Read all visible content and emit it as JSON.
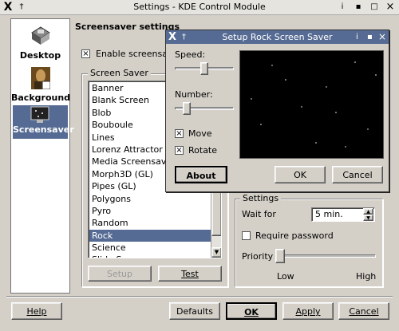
{
  "window": {
    "title": "Settings - KDE Control Module",
    "x_glyph": "X",
    "pin_glyph": "†",
    "btn_info": "i",
    "btn_min": "▪",
    "btn_max": "□",
    "btn_close": "×"
  },
  "sidebar": {
    "items": [
      {
        "label": "Desktop",
        "icon": "desktop-icon"
      },
      {
        "label": "Background",
        "icon": "background-icon"
      },
      {
        "label": "Screensaver",
        "icon": "screensaver-icon",
        "selected": true
      }
    ]
  },
  "main": {
    "heading": "Screensaver settings",
    "enable_label": "Enable screensave",
    "enable_checked": true,
    "saver_group_title": "Screen Saver",
    "savers": [
      "Banner",
      "Blank Screen",
      "Blob",
      "Bouboule",
      "Lines",
      "Lorenz Attractor",
      "Media Screensaver",
      "Morph3D (GL)",
      "Pipes (GL)",
      "Polygons",
      "Pyro",
      "Random",
      "Rock",
      "Science",
      "Slide Screen"
    ],
    "selected_saver": "Rock",
    "setup_label": "Setup",
    "test_label": "Test",
    "settings_group_title": "Settings",
    "wait_label": "Wait for",
    "wait_value": "5 min.",
    "require_password_label": "Require password",
    "require_password_checked": false,
    "priority_label": "Priority",
    "priority_low": "Low",
    "priority_high": "High",
    "priority_level": 0.0
  },
  "dialog": {
    "title": "Setup Rock Screen Saver",
    "speed_label": "Speed:",
    "speed_level": 0.5,
    "number_label": "Number:",
    "number_level": 0.15,
    "move_label": "Move",
    "move_checked": true,
    "rotate_label": "Rotate",
    "rotate_checked": true,
    "about_label": "About",
    "ok_label": "OK",
    "cancel_label": "Cancel"
  },
  "footer": {
    "help_label": "Help",
    "defaults_label": "Defaults",
    "ok_label": "OK",
    "apply_label": "Apply",
    "cancel_label": "Cancel"
  },
  "colors": {
    "selection": "#566b93",
    "face": "#d4d0c8",
    "preview_bg": "#000000"
  }
}
